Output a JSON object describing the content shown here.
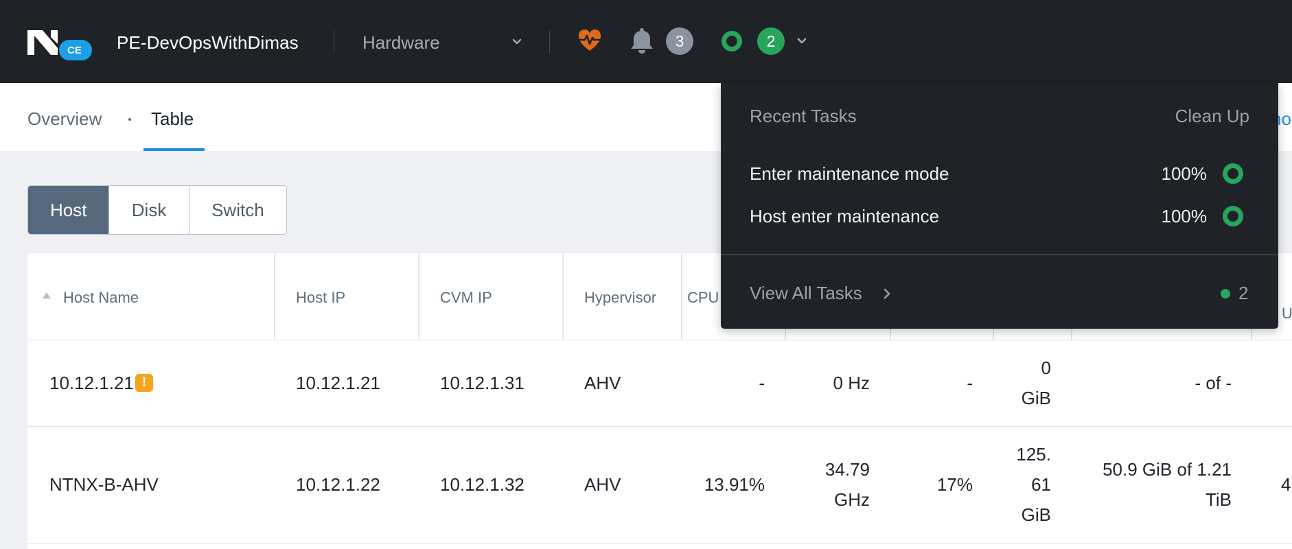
{
  "header": {
    "logo_badge": "CE",
    "cluster_name": "PE-DevOpsWithDimas",
    "menu_selected": "Hardware",
    "alert_count": "3",
    "task_count": "2",
    "icons": {
      "logo": "nutanix-logo",
      "menu_dropdown": "chevron-down-icon",
      "health": "health-heartbeat-icon",
      "alerts": "bell-icon",
      "tasks": "task-ring-icon",
      "tasks_dropdown": "chevron-down-icon"
    },
    "colors": {
      "health": "#e06a1b",
      "success": "#27a55b",
      "alert_badge": "#8b939c"
    }
  },
  "subnav": {
    "tabs": [
      {
        "label": "Overview",
        "active": false
      },
      {
        "label": "Table",
        "active": true
      }
    ],
    "cut_link": "ho",
    "accent": "#1b8fe0"
  },
  "segmented": {
    "buttons": [
      {
        "label": "Host",
        "active": true
      },
      {
        "label": "Disk",
        "active": false
      },
      {
        "label": "Switch",
        "active": false
      }
    ]
  },
  "table": {
    "columns": {
      "host_name": "Host Name",
      "host_ip": "Host IP",
      "cvm_ip": "CVM IP",
      "hypervisor": "Hypervisor",
      "cpu": "CPU",
      "cut_right": "U"
    },
    "sort": {
      "column": "host_name",
      "direction": "ascending"
    },
    "rows": [
      {
        "host_name": "10.12.1.21",
        "has_warning": true,
        "warning_glyph": "!",
        "host_ip": "10.12.1.21",
        "cvm_ip": "10.12.1.31",
        "hypervisor": "AHV",
        "cpu_usage": "-",
        "cpu_capacity": "0 Hz",
        "memory_usage": "-",
        "memory_capacity": [
          "0",
          "GiB"
        ],
        "storage": [
          "- of -"
        ],
        "cut_right": ""
      },
      {
        "host_name": "NTNX-B-AHV",
        "has_warning": false,
        "host_ip": "10.12.1.22",
        "cvm_ip": "10.12.1.32",
        "hypervisor": "AHV",
        "cpu_usage": "13.91%",
        "cpu_capacity": [
          "34.79",
          "GHz"
        ],
        "memory_usage": "17%",
        "memory_capacity": [
          "125.",
          "61",
          "GiB"
        ],
        "storage": [
          "50.9 GiB of 1.21",
          "TiB"
        ],
        "cut_right": "4"
      }
    ]
  },
  "recent_tasks": {
    "title": "Recent Tasks",
    "clean_up": "Clean Up",
    "items": [
      {
        "name": "Enter maintenance mode",
        "percent": "100%",
        "status": "succeeded"
      },
      {
        "name": "Host enter maintenance",
        "percent": "100%",
        "status": "succeeded"
      }
    ],
    "view_all": "View All Tasks",
    "running_count": "2"
  }
}
